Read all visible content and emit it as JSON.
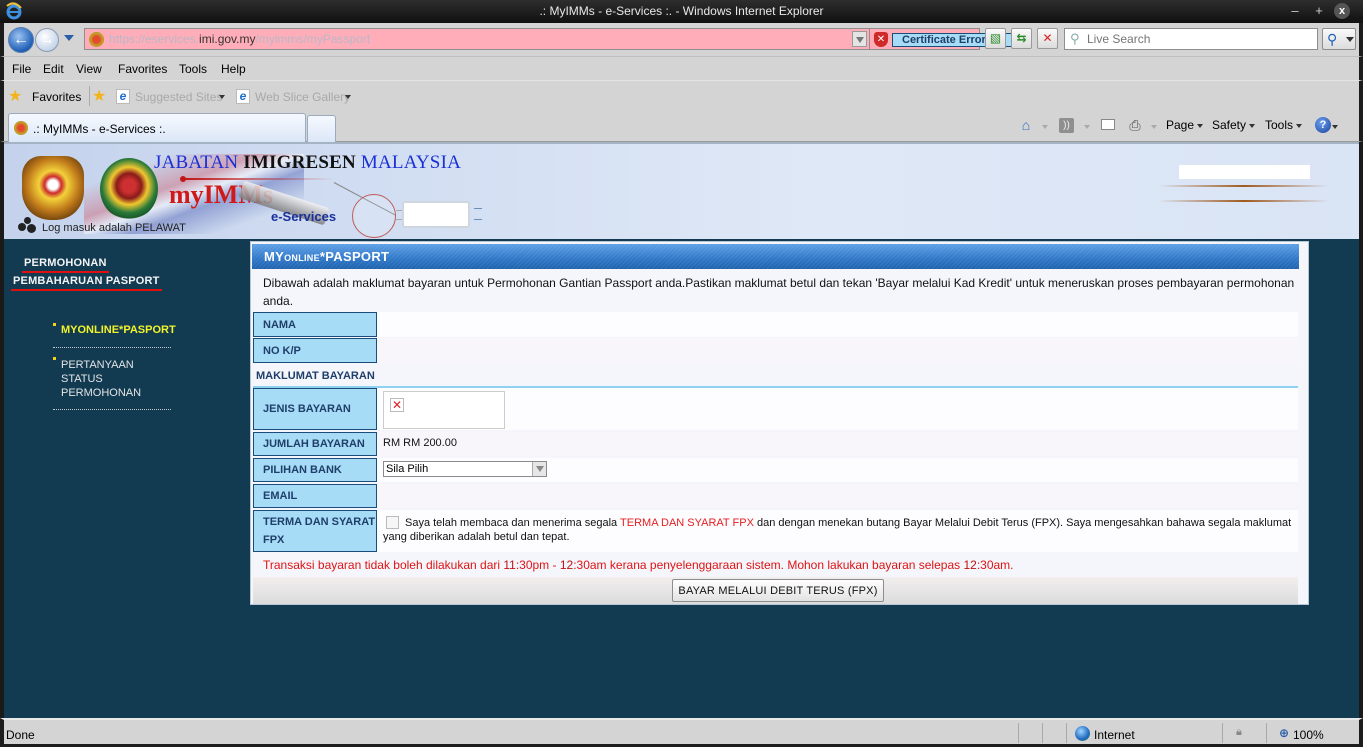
{
  "window": {
    "title": ".: MyIMMs - e-Services :. - Windows Internet Explorer",
    "minimize": "‒",
    "maximize": "+",
    "close": "x"
  },
  "navbar": {
    "url_prefix": "https://eservices.",
    "url_domain": "imi.gov.my",
    "url_path": "/myimms/myPassport",
    "certificate_error": "Certificate Error",
    "search_placeholder": "Live Search"
  },
  "menu": [
    "File",
    "Edit",
    "View",
    "Favorites",
    "Tools",
    "Help"
  ],
  "favorites_bar": {
    "favorites_label": "Favorites",
    "links": [
      "Suggested Sites",
      "Web Slice Gallery"
    ]
  },
  "tabs": {
    "active_tab": ".: MyIMMs - e-Services :."
  },
  "command_bar": {
    "page": "Page",
    "safety": "Safety",
    "tools": "Tools",
    "help_icon": "?"
  },
  "banner": {
    "title_part1": "JABATAN ",
    "title_part2": "IMIGRESEN",
    "title_part3": " MALAYSIA",
    "app_name": "myIMMs",
    "app_sub": "e-Services",
    "login_status": "Log masuk adalah PELAWAT"
  },
  "sidebar": {
    "heading1": "PERMOHONAN",
    "heading2": "PEMBAHARUAN PASPORT",
    "items": [
      {
        "label": "MYONLINE*PASPORT",
        "active": true
      },
      {
        "label_lines": [
          "PERTANYAAN",
          "STATUS",
          "PERMOHONAN"
        ],
        "active": false
      }
    ]
  },
  "panel": {
    "title_big1": "MY",
    "title_small": "ONLINE",
    "title_big2": "*PASPORT",
    "intro": "Dibawah adalah maklumat bayaran untuk Permohonan Gantian Passport anda.Pastikan maklumat betul dan tekan 'Bayar melalui Kad Kredit' untuk meneruskan proses pembayaran permohonan anda.",
    "fields": {
      "nama_label": "NAMA",
      "nama_value": "",
      "nokp_label": "NO K/P",
      "nokp_value": ""
    },
    "section_title": "MAKLUMAT BAYARAN",
    "payment": {
      "jenis_label": "JENIS BAYARAN",
      "jumlah_label": "JUMLAH BAYARAN",
      "jumlah_value": "RM RM 200.00",
      "bank_label": "PILIHAN BANK",
      "bank_selected": "Sila Pilih",
      "email_label": "EMAIL",
      "email_value": "",
      "terms_label_line1": "TERMA DAN SYARAT",
      "terms_label_line2": "FPX",
      "terms_checked": false,
      "terms_text_before": "Saya telah membaca dan menerima segala ",
      "terms_link": "TERMA DAN SYARAT FPX",
      "terms_text_after": " dan dengan menekan butang Bayar Melalui Debit Terus (FPX). Saya mengesahkan bahawa segala maklumat yang diberikan adalah betul dan tepat."
    },
    "warning_part1": "Transaksi bayaran tidak boleh dilakukan dari ",
    "warning_time1": "11",
    "warning_part2": ":30pm - ",
    "warning_time2": "12",
    "warning_part3": ":30am kerana penyelenggaraan sistem. Mohon lakukan bayaran selepas ",
    "warning_time3": "12",
    "warning_part4": ":30am.",
    "pay_button": "BAYAR MELALUI DEBIT TERUS (FPX)"
  },
  "statusbar": {
    "status": "Done",
    "zone": "Internet",
    "zoom": "100%"
  },
  "colors": {
    "page_background": "#123b52",
    "panel_header": "#2f77c8",
    "label_fill": "#a7dcf6",
    "warning_red": "#e01414",
    "sidebar_active": "#f3f32a",
    "address_bar_error": "#ffadb9"
  }
}
